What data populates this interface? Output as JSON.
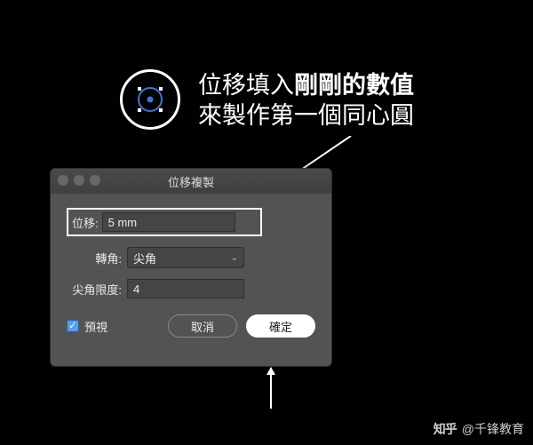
{
  "annotation": {
    "line1_prefix": "位移填入",
    "line1_bold": "剛剛的數值",
    "line2": "來製作第一個同心圓"
  },
  "dialog": {
    "title": "位移複製",
    "offset_label": "位移:",
    "offset_value": "5 mm",
    "corner_label": "轉角:",
    "corner_value": "尖角",
    "miter_label": "尖角限度:",
    "miter_value": "4",
    "preview_label": "預視",
    "cancel_label": "取消",
    "ok_label": "確定"
  },
  "watermark": {
    "site": "知乎",
    "author": "@千锋教育"
  },
  "icons": {
    "top": "target-circle-icon"
  }
}
